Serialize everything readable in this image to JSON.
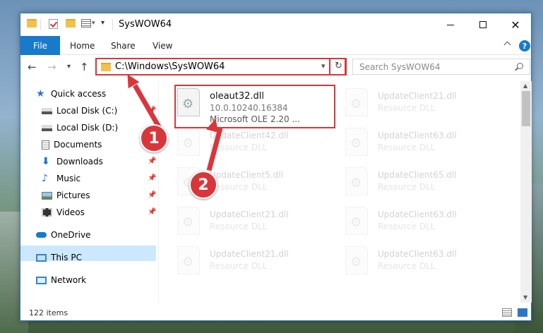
{
  "window": {
    "title": "SysWOW64"
  },
  "ribbon": {
    "file": "File",
    "tabs": [
      "Home",
      "Share",
      "View"
    ],
    "help": "?"
  },
  "address": {
    "path": "C:\\Windows\\SysWOW64"
  },
  "search": {
    "placeholder": "Search SysWOW64"
  },
  "sidebar": {
    "items": [
      {
        "label": "Quick access"
      },
      {
        "label": "Local Disk (C:)"
      },
      {
        "label": "Local Disk (D:)"
      },
      {
        "label": "Documents"
      },
      {
        "label": "Downloads"
      },
      {
        "label": "Music"
      },
      {
        "label": "Pictures"
      },
      {
        "label": "Videos"
      },
      {
        "label": "OneDrive"
      },
      {
        "label": "This PC"
      },
      {
        "label": "Network"
      }
    ]
  },
  "files": {
    "highlighted": {
      "name": "oleaut32.dll",
      "version": "10.0.10240.16384",
      "desc": "Microsoft OLE 2.20 ..."
    },
    "items": [
      {
        "name": "UpdateClient21.dll",
        "type": "Resource DLL"
      },
      {
        "name": "UpdateClient42.dll",
        "type": "Resource DLL"
      },
      {
        "name": "UpdateClient63.dll",
        "type": "Resource DLL"
      },
      {
        "name": "UpdateClient5.dll",
        "type": "Resource DLL"
      },
      {
        "name": "UpdateClient65.dll",
        "type": "Resource DLL"
      },
      {
        "name": "UpdateClient21.dll",
        "type": "Resource DLL"
      },
      {
        "name": "UpdateClient63.dll",
        "type": "Resource DLL"
      },
      {
        "name": "UpdateClient21.dll",
        "type": "Resource DLL"
      },
      {
        "name": "UpdateClient63.dll",
        "type": "Resource DLL"
      }
    ]
  },
  "status": {
    "count": "122 items"
  },
  "annotations": {
    "badge1": "1",
    "badge2": "2",
    "color": "#d9363b"
  }
}
